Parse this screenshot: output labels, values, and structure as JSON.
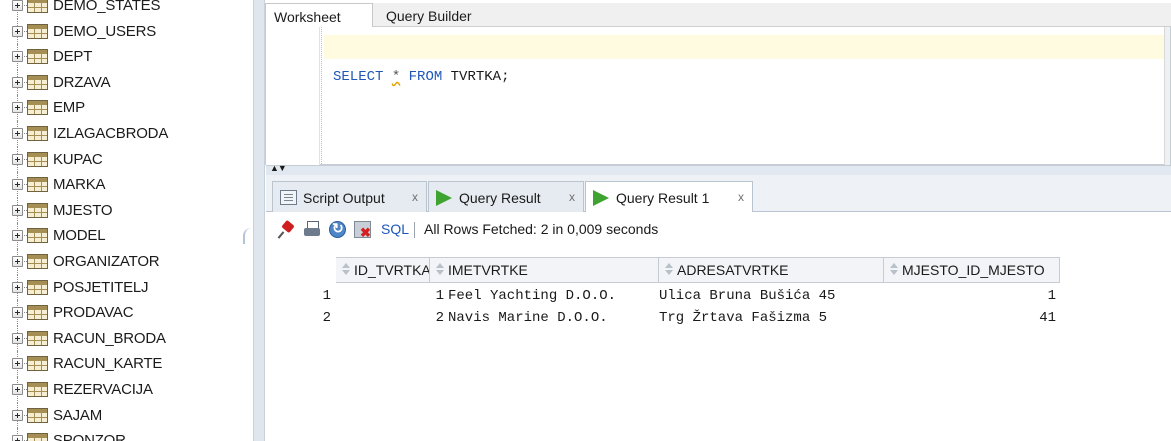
{
  "tree": {
    "items": [
      "DEMO_STATES",
      "DEMO_USERS",
      "DEPT",
      "DRZAVA",
      "EMP",
      "IZLAGACBRODA",
      "KUPAC",
      "MARKA",
      "MJESTO",
      "MODEL",
      "ORGANIZATOR",
      "POSJETITELJ",
      "PRODAVAC",
      "RACUN_BRODA",
      "RACUN_KARTE",
      "REZERVACIJA",
      "SAJAM",
      "SPONZOR"
    ]
  },
  "editor": {
    "tabs": [
      "Worksheet",
      "Query Builder"
    ],
    "sql": {
      "select": "SELECT",
      "star": "*",
      "from": "FROM",
      "rest": "TVRTKA;"
    }
  },
  "results": {
    "tabs": [
      {
        "label": "Script Output",
        "close": "x",
        "icon": "script-output-icon"
      },
      {
        "label": "Query Result",
        "close": "x",
        "icon": "run-query-icon"
      },
      {
        "label": "Query Result 1",
        "close": "x",
        "icon": "run-query-icon"
      }
    ],
    "toolbar": {
      "sql_label": "SQL",
      "separator": "|",
      "status": "All Rows Fetched: 2 in 0,009 seconds"
    },
    "columns": [
      "ID_TVRTKA",
      "IMETVRTKE",
      "ADRESATVRTKE",
      "MJESTO_ID_MJESTO"
    ],
    "rows": [
      {
        "rownum": "1",
        "cells": [
          "1",
          "Feel Yachting D.O.O.",
          "Ulica Bruna Bušića 45",
          "1"
        ]
      },
      {
        "rownum": "2",
        "cells": [
          "2",
          "Navis Marine D.O.O.",
          "Trg Žrtava Fašizma 5",
          "41"
        ]
      }
    ]
  },
  "colors": {
    "keyword": "#1f57b9",
    "run_icon": "#3fa332",
    "panel_bg": "#eef1f5"
  }
}
